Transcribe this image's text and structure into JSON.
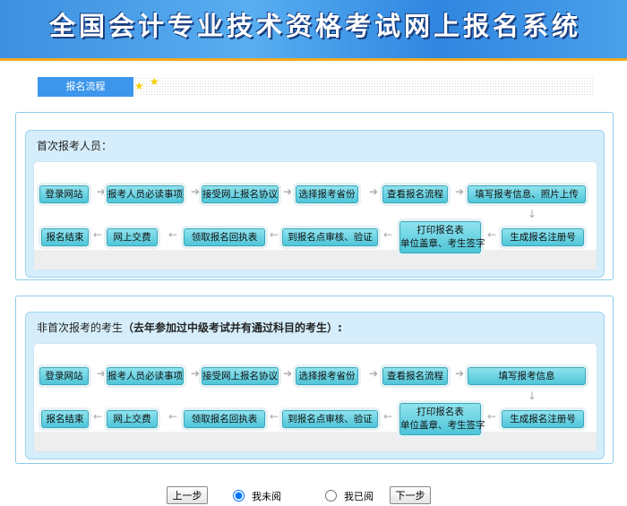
{
  "header": {
    "title": "全国会计专业技术资格考试网上报名系统"
  },
  "tab": {
    "label": "报名流程"
  },
  "sections": [
    {
      "title": "首次报考人员：",
      "row1": [
        "登录网站",
        "报考人员必读事项",
        "接受网上报名协议",
        "选择报考省份",
        "查看报名流程",
        "填写报考信息、照片上传"
      ],
      "row2": [
        "报名结束",
        "网上交费",
        "领取报名回执表",
        "到报名点审核、验证",
        "打印报名表",
        "单位盖章、考生签字",
        "生成报名注册号"
      ]
    },
    {
      "title": "非首次报考的考生",
      "subtitle": "（去年参加过中级考试并有通过科目的考生）:",
      "row1": [
        "登录网站",
        "报考人员必读事项",
        "接受网上报名协议",
        "选择报考省份",
        "查看报名流程",
        "填写报考信息"
      ],
      "row2": [
        "报名结束",
        "网上交费",
        "领取报名回执表",
        "到报名点审核、验证",
        "打印报名表",
        "单位盖章、考生签字",
        "生成报名注册号"
      ]
    }
  ],
  "footer": {
    "prev": "上一步",
    "next": "下一步",
    "radio_unread": "我未阅",
    "radio_read": "我已阅",
    "selected": "我未阅"
  }
}
